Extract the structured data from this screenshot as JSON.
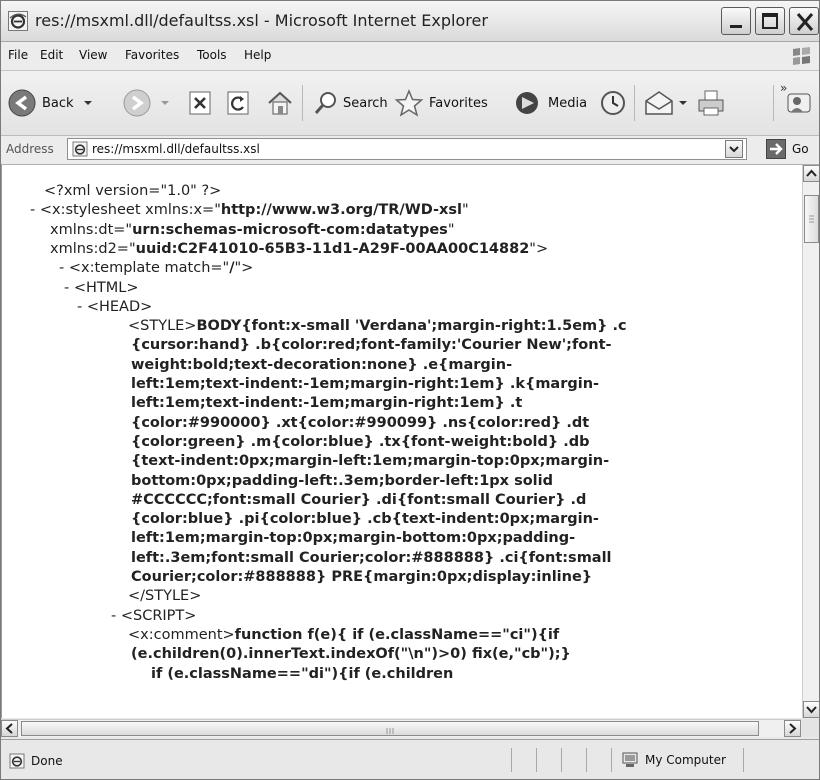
{
  "window": {
    "title": "res://msxml.dll/defaultss.xsl - Microsoft Internet Explorer"
  },
  "menu": [
    "File",
    "Edit",
    "View",
    "Favorites",
    "Tools",
    "Help"
  ],
  "toolbar": {
    "back_label": "Back",
    "search_label": "Search",
    "favorites_label": "Favorites",
    "media_label": "Media",
    "overflow": "»"
  },
  "address": {
    "label": "Address",
    "url": "res://msxml.dll/defaultss.xsl",
    "go_label": "Go"
  },
  "content": {
    "lines": [
      {
        "prefix": "",
        "text": "<?xml version=\"1.0\" ?>",
        "bold": ""
      },
      {
        "prefix": "- ",
        "text": "<x:stylesheet xmlns:x=\"",
        "bold": "http://www.w3.org/TR/WD-xsl",
        "after": "\""
      },
      {
        "prefix": "",
        "text": "xmlns:dt=\"",
        "bold": "urn:schemas-microsoft-com:datatypes",
        "after": "\""
      },
      {
        "prefix": "",
        "text": "xmlns:d2=\"",
        "bold": "uuid:C2F41010-65B3-11d1-A29F-00AA00C14882",
        "after": "\">"
      },
      {
        "prefix": "- ",
        "text": "<x:template match=\"",
        "bold": "/",
        "after": "\">"
      },
      {
        "prefix": "- ",
        "text": "<HTML>",
        "bold": ""
      },
      {
        "prefix": "- ",
        "text": "<HEAD>",
        "bold": ""
      },
      {
        "prefix": "",
        "text": "<STYLE>",
        "bold": "BODY{font:x-small 'Verdana';margin-right:1.5em} .c"
      },
      {
        "prefix": "",
        "text": "",
        "bold": "{cursor:hand} .b{color:red;font-family:'Courier New';font-"
      },
      {
        "prefix": "",
        "text": "",
        "bold": "weight:bold;text-decoration:none} .e{margin-"
      },
      {
        "prefix": "",
        "text": "",
        "bold": "left:1em;text-indent:-1em;margin-right:1em} .k{margin-"
      },
      {
        "prefix": "",
        "text": "",
        "bold": "left:1em;text-indent:-1em;margin-right:1em} .t"
      },
      {
        "prefix": "",
        "text": "",
        "bold": "{color:#990000} .xt{color:#990099} .ns{color:red} .dt"
      },
      {
        "prefix": "",
        "text": "",
        "bold": "{color:green} .m{color:blue} .tx{font-weight:bold} .db"
      },
      {
        "prefix": "",
        "text": "",
        "bold": "{text-indent:0px;margin-left:1em;margin-top:0px;margin-"
      },
      {
        "prefix": "",
        "text": "",
        "bold": "bottom:0px;padding-left:.3em;border-left:1px solid"
      },
      {
        "prefix": "",
        "text": "",
        "bold": "#CCCCCC;font:small Courier} .di{font:small Courier} .d"
      },
      {
        "prefix": "",
        "text": "",
        "bold": "{color:blue} .pi{color:blue} .cb{text-indent:0px;margin-"
      },
      {
        "prefix": "",
        "text": "",
        "bold": "left:1em;margin-top:0px;margin-bottom:0px;padding-"
      },
      {
        "prefix": "",
        "text": "",
        "bold": "left:.3em;font:small Courier;color:#888888} .ci{font:small"
      },
      {
        "prefix": "",
        "text": "",
        "bold": "Courier;color:#888888} PRE{margin:0px;display:inline}"
      },
      {
        "prefix": "",
        "text": "</STYLE>",
        "bold": ""
      },
      {
        "prefix": "- ",
        "text": "<SCRIPT>",
        "bold": ""
      },
      {
        "prefix": "",
        "text": "<x:comment>",
        "bold": "function f(e){ if (e.className==\"ci\"){if"
      },
      {
        "prefix": "",
        "text": "",
        "bold": "(e.children(0).innerText.indexOf(\"\\n\")>0) fix(e,\"cb\");}"
      },
      {
        "prefix": "",
        "text": "",
        "bold": "if (e.className==\"di\"){if (e.children"
      }
    ]
  },
  "status": {
    "text": "Done",
    "zone": "My Computer"
  }
}
